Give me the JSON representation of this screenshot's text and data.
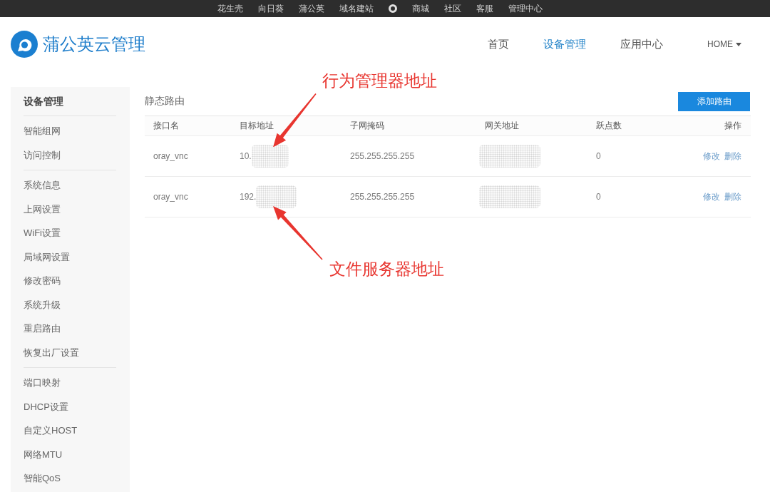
{
  "top_bar": {
    "items": [
      {
        "kind": "link",
        "label": "花生壳"
      },
      {
        "kind": "link",
        "label": "向日葵"
      },
      {
        "kind": "link",
        "label": "蒲公英"
      },
      {
        "kind": "link",
        "label": "域名建站"
      },
      {
        "kind": "icon"
      },
      {
        "kind": "link",
        "label": "商城"
      },
      {
        "kind": "link",
        "label": "社区"
      },
      {
        "kind": "link",
        "label": "客服"
      },
      {
        "kind": "link",
        "label": "管理中心"
      }
    ]
  },
  "header": {
    "brand": "蒲公英云管理",
    "nav": [
      {
        "label": "首页",
        "selected": false
      },
      {
        "label": "设备管理",
        "selected": true
      },
      {
        "label": "应用中心",
        "selected": false
      }
    ],
    "account_menu": "HOME"
  },
  "sidebar": {
    "title": "设备管理",
    "groups": [
      {
        "items": [
          {
            "label": "智能组网",
            "selected": false
          },
          {
            "label": "访问控制",
            "selected": false
          }
        ]
      },
      {
        "items": [
          {
            "label": "系统信息",
            "selected": false
          },
          {
            "label": "上网设置",
            "selected": false
          },
          {
            "label": "WiFi设置",
            "selected": false
          },
          {
            "label": "局域网设置",
            "selected": false
          },
          {
            "label": "修改密码",
            "selected": false
          },
          {
            "label": "系统升级",
            "selected": false
          },
          {
            "label": "重启路由",
            "selected": false
          },
          {
            "label": "恢复出厂设置",
            "selected": false
          }
        ]
      },
      {
        "items": [
          {
            "label": "端口映射",
            "selected": false
          },
          {
            "label": "DHCP设置",
            "selected": false
          },
          {
            "label": "自定义HOST",
            "selected": false
          },
          {
            "label": "网络MTU",
            "selected": false
          },
          {
            "label": "智能QoS",
            "selected": false
          }
        ]
      }
    ]
  },
  "content": {
    "title": "静态路由",
    "add_button": "添加路由",
    "table": {
      "columns": [
        "接口名",
        "目标地址",
        "子网掩码",
        "网关地址",
        "跃点数",
        "操作"
      ],
      "rows": [
        {
          "interface": "oray_vnc",
          "destination": {
            "text": "10.",
            "redacted": true
          },
          "mask": "255.255.255.255",
          "gateway": {
            "redacted": true
          },
          "metric": "0",
          "actions": [
            "修改",
            "删除"
          ]
        },
        {
          "interface": "oray_vnc",
          "destination": {
            "text": "192.",
            "redacted": true
          },
          "mask": "255.255.255.255",
          "gateway": {
            "redacted": true
          },
          "metric": "0",
          "actions": [
            "修改",
            "删除"
          ]
        }
      ]
    }
  },
  "annotations": [
    {
      "text": "行为管理器地址"
    },
    {
      "text": "文件服务器地址"
    }
  ]
}
